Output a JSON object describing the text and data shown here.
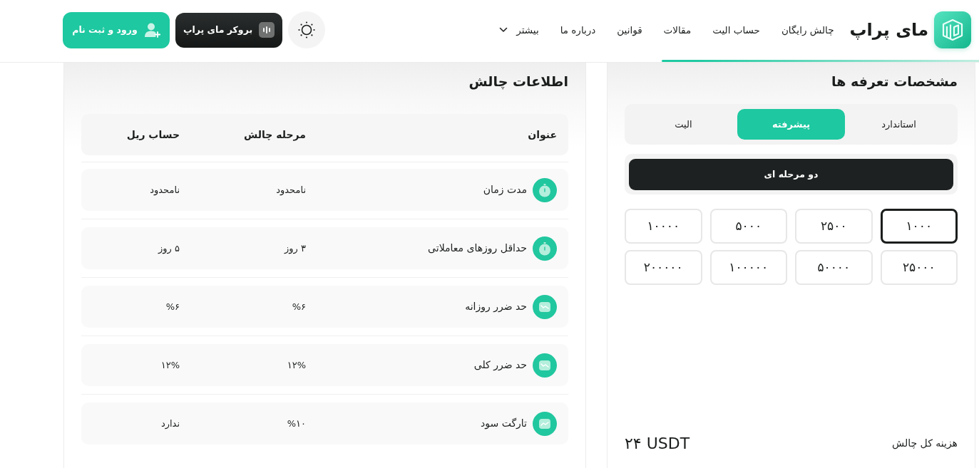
{
  "header": {
    "logo_text": "مای پراپ",
    "nav": [
      {
        "label": "چالش رایگان",
        "kind": "link"
      },
      {
        "label": "حساب الیت",
        "kind": "link"
      },
      {
        "label": "مقالات",
        "kind": "link"
      },
      {
        "label": "قوانین",
        "kind": "link"
      },
      {
        "label": "درباره ما",
        "kind": "link"
      },
      {
        "label": "بیشتر",
        "kind": "dropdown"
      }
    ],
    "broker_button": "بروکر مای پراپ",
    "login_button": "ورود و ثبت نام"
  },
  "pricing": {
    "title": "مشخصات تعرفه ها",
    "plans": [
      {
        "label": "استاندارد",
        "selected": false
      },
      {
        "label": "پیشرفته",
        "selected": true
      },
      {
        "label": "الیت",
        "selected": false
      }
    ],
    "steps": [
      {
        "label": "دو مرحله ای",
        "selected": true
      }
    ],
    "amounts": [
      {
        "label": "۱۰۰۰",
        "selected": true
      },
      {
        "label": "۲۵۰۰",
        "selected": false
      },
      {
        "label": "۵۰۰۰",
        "selected": false
      },
      {
        "label": "۱۰۰۰۰",
        "selected": false
      },
      {
        "label": "۲۵۰۰۰",
        "selected": false
      },
      {
        "label": "۵۰۰۰۰",
        "selected": false
      },
      {
        "label": "۱۰۰۰۰۰",
        "selected": false
      },
      {
        "label": "۲۰۰۰۰۰",
        "selected": false
      }
    ],
    "total": {
      "label": "هزینه کل چالش",
      "value": "۲۴ USDT"
    }
  },
  "challenge_info": {
    "title": "اطلاعات چالش",
    "columns": [
      "عنوان",
      "مرحله چالش",
      "حساب ریل"
    ],
    "rows": [
      {
        "kind": "timer",
        "title": "مدت زمان",
        "challenge": "نامحدود",
        "real": "نامحدود"
      },
      {
        "kind": "timer",
        "title": "حداقل روزهای معاملاتی",
        "challenge": "۳ روز",
        "real": "۵ روز"
      },
      {
        "kind": "loss",
        "title": "حد ضرر روزانه",
        "challenge": "%۶",
        "real": "%۶"
      },
      {
        "kind": "loss",
        "title": "حد ضرر کلی",
        "challenge": "۱۲%",
        "real": "۱۲%"
      },
      {
        "kind": "profit",
        "title": "تارگت سود",
        "challenge": "%۱۰",
        "real": "ندارد"
      }
    ]
  }
}
